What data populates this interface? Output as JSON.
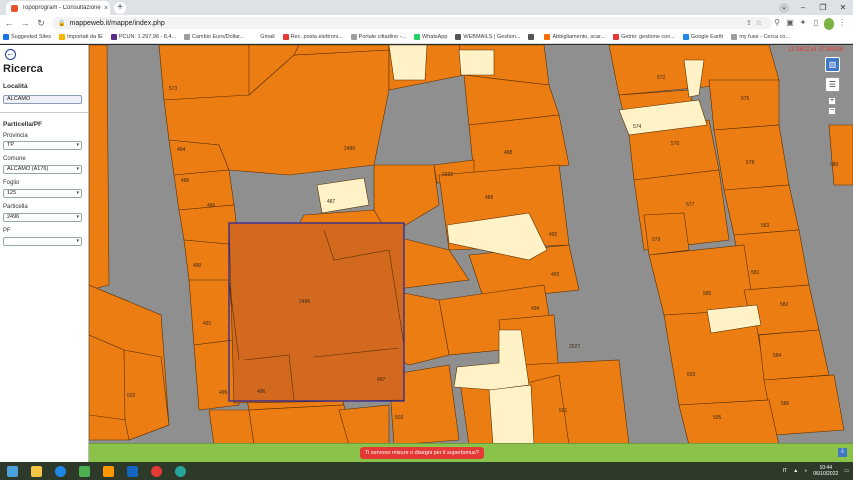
{
  "browser": {
    "tab_title": "Topoprogram - Consultazione m",
    "tab_close": "×",
    "new_tab": "+",
    "url": "mappeweb.it/mappe/index.php",
    "win_min": "–",
    "win_max": "❐",
    "win_close": "✕",
    "bookmarks": [
      {
        "label": "Suggested Sites",
        "color": "#1a73e8"
      },
      {
        "label": "Importati da IE",
        "color": "#f4b400"
      },
      {
        "label": "PCUN: 1.297,98 - 8,4...",
        "color": "#5b2c8e"
      },
      {
        "label": "Cambio Euro/Dollar...",
        "color": "#9e9e9e"
      },
      {
        "label": "Gmail",
        "color": "#ffffff"
      },
      {
        "label": "Rec. posta elettroni...",
        "color": "#e53935"
      },
      {
        "label": "Portale cittadino -...",
        "color": "#9e9e9e"
      },
      {
        "label": "WhatsApp",
        "color": "#25d366"
      },
      {
        "label": "WEBMAILS | Gestion...",
        "color": "#555555"
      },
      {
        "label": "",
        "color": "#555555"
      },
      {
        "label": "Abbigliamento, scar...",
        "color": "#ff6f00"
      },
      {
        "label": "Getrio: gestione con...",
        "color": "#e53935"
      },
      {
        "label": "Google Earth",
        "color": "#1e88e5"
      },
      {
        "label": "my fuse - Cerca co...",
        "color": "#9e9e9e"
      }
    ]
  },
  "sidebar": {
    "back_icon": "←",
    "title": "Ricerca",
    "localita_label": "Località",
    "localita_value": "ALCAMO",
    "section_title": "Particella/PF",
    "provincia_label": "Provincia",
    "provincia_value": "TP",
    "comune_label": "Comune",
    "comune_value": "ALCAMO (A176)",
    "foglio_label": "Foglio",
    "foglio_value": "125",
    "particella_label": "Particella",
    "particella_value": "2496",
    "pf_label": "PF",
    "pf_value": "",
    "dropdown_icon": "▾"
  },
  "map": {
    "coords": "12.962214 37.98938",
    "layers_icon": "▥",
    "list_icon": "☰",
    "zoom_in": "+",
    "zoom_out": "−",
    "superbonus_label": "Ti servono misure o disegni per il superbonus?",
    "scroll_icon": "⇩",
    "colors": {
      "parcel": "#ec7d12",
      "highlight": "#d2691e",
      "building": "#fff2c6",
      "road": "#8f8f8f",
      "selection": "#2b2a9a"
    },
    "parcels": [
      "573",
      "2490",
      "484",
      "485",
      "486",
      "487",
      "2332",
      "488",
      "489",
      "490",
      "491",
      "492",
      "493",
      "494",
      "2496",
      "495",
      "496",
      "497",
      "2527",
      "503",
      "501",
      "502",
      "572",
      "575",
      "574",
      "576",
      "578",
      "577",
      "579",
      "583",
      "585",
      "581",
      "580",
      "582",
      "584",
      "586",
      "593",
      "595",
      "583"
    ]
  },
  "taskbar": {
    "time": "10:44",
    "date": "06/10/2022",
    "lang": "IT"
  }
}
